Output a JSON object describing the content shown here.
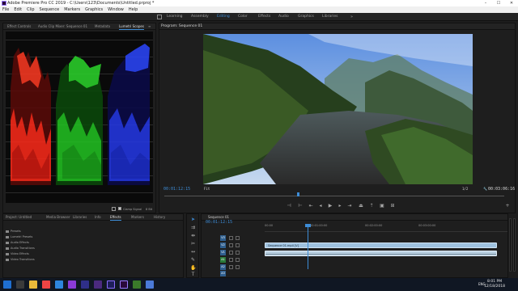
{
  "window": {
    "title": "Adobe Premiere Pro CC 2019 - C:\\Users\\123\\Documents\\Untitled.prproj *",
    "controls": [
      "–",
      "☐",
      "✕"
    ]
  },
  "menu": [
    "File",
    "Edit",
    "Clip",
    "Sequence",
    "Markers",
    "Graphics",
    "Window",
    "Help"
  ],
  "workspaces": {
    "items": [
      "Learning",
      "Assembly",
      "Editing",
      "Color",
      "Effects",
      "Audio",
      "Graphics",
      "Libraries"
    ],
    "active": "Editing",
    "more": "»"
  },
  "source_panel": {
    "tabs": [
      "Effect Controls",
      "Audio Clip Mixer: Sequence 01",
      "Metadata",
      "Lumetri Scopes"
    ],
    "active_tab": "Lumetri Scopes",
    "menu_icon": "≡",
    "footer": {
      "clamp_label": "Clamp Signal",
      "bit_depth": "8 Bit"
    }
  },
  "program_monitor": {
    "title": "Program: Sequence 01",
    "timecode": "00:01:12:15",
    "fit": "Fit",
    "fraction": "1/2",
    "duration": "00:03:06:16"
  },
  "project_panel": {
    "tabs": [
      "Project: Untitled",
      "Media Browser",
      "Libraries",
      "Info",
      "Effects",
      "Markers",
      "History"
    ],
    "active_tab": "Effects",
    "items": [
      "Presets",
      "Lumetri Presets",
      "Audio Effects",
      "Audio Transitions",
      "Video Effects",
      "Video Transitions"
    ]
  },
  "timeline": {
    "sequence_tab": "Sequence 01",
    "timecode": "00:01:12:15",
    "ruler_labels": [
      "00:00",
      "00:01:00:00",
      "00:02:00:00",
      "00:03:00:00"
    ],
    "video_tracks": [
      "V3",
      "V2",
      "V1"
    ],
    "audio_tracks": [
      "A1",
      "A2",
      "A3"
    ],
    "video_clip": "Sequence 01.mp4 [V]",
    "audio_clip": ""
  },
  "taskbar": {
    "time": "8:01 PM",
    "date": "12/18/2018",
    "language": "ENG"
  },
  "colors": {
    "accent": "#3d8cd6",
    "clip_video": "#9fc2e0",
    "clip_audio": "#b8cfe0",
    "scope_red": "#ff2a1a",
    "scope_green": "#2bd62b",
    "scope_blue": "#2c46ff"
  }
}
